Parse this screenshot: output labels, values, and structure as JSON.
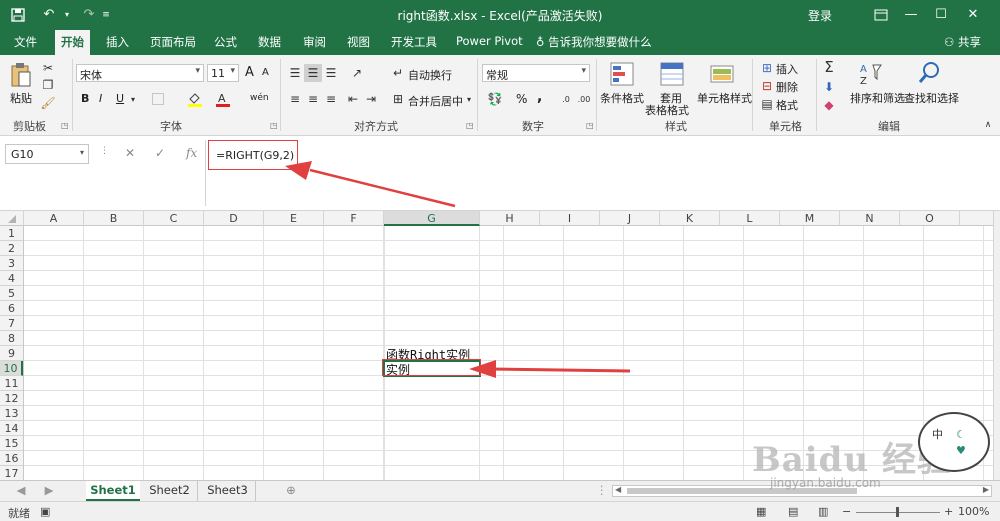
{
  "app": {
    "title": "right函数.xlsx - Excel(产品激活失败)",
    "login": "登录",
    "quick_access": {
      "save_icon": "save-icon",
      "undo_icon": "undo-icon",
      "redo_icon": "redo-icon",
      "customize_icon": "customize-icon"
    },
    "window_buttons": {
      "ribbon_display": "ribbon-display-icon",
      "minimize": "minimize-icon",
      "maximize": "maximize-icon",
      "close": "close-icon"
    }
  },
  "tabs": [
    "文件",
    "开始",
    "插入",
    "页面布局",
    "公式",
    "数据",
    "审阅",
    "视图",
    "开发工具",
    "Power Pivot"
  ],
  "active_tab": "开始",
  "tell_me": "告诉我你想要做什么",
  "share": "共享",
  "ribbon": {
    "clipboard": {
      "paste": "粘贴",
      "label": "剪贴板"
    },
    "font": {
      "name": "宋体",
      "size": "11",
      "bold": "B",
      "italic": "I",
      "underline": "U",
      "phonetic": "wén",
      "grow": "A",
      "shrink": "A",
      "label": "字体"
    },
    "alignment": {
      "wrap": "自动换行",
      "merge": "合并后居中",
      "label": "对齐方式"
    },
    "number": {
      "format": "常规",
      "percent": "%",
      "comma": ",",
      "label": "数字"
    },
    "styles": {
      "conditional": "条件格式",
      "table_line1": "套用",
      "table_line2": "表格格式",
      "cell_styles": "单元格样式",
      "label": "样式"
    },
    "cells": {
      "insert": "插入",
      "delete": "删除",
      "format": "格式",
      "label": "单元格"
    },
    "editing": {
      "sort": "排序和筛选",
      "find": "查找和选择",
      "label": "编辑"
    }
  },
  "formula_bar": {
    "name_box": "G10",
    "formula": "=RIGHT(G9,2)",
    "cancel": "✕",
    "enter": "✓",
    "fx": "fx"
  },
  "columns": [
    "A",
    "B",
    "C",
    "D",
    "E",
    "F",
    "G",
    "H",
    "I",
    "J",
    "K",
    "L",
    "M",
    "N",
    "O"
  ],
  "selected_column": "G",
  "rows": [
    "1",
    "2",
    "3",
    "4",
    "5",
    "6",
    "7",
    "8",
    "9",
    "10",
    "11",
    "12",
    "13",
    "14",
    "15",
    "16",
    "17"
  ],
  "selected_row": "10",
  "cells": {
    "G9": "函数Right实例",
    "G10": "实例"
  },
  "sheets": [
    "Sheet1",
    "Sheet2",
    "Sheet3"
  ],
  "active_sheet": "Sheet1",
  "status": {
    "ready": "就绪",
    "zoom": "100%"
  },
  "watermark": {
    "text": "Baidu 经验",
    "url": "jingyan.baidu.com"
  },
  "bubble": {
    "char1": "中",
    "char2": "☾",
    "char3": "♥"
  },
  "colors": {
    "excel_green": "#217346",
    "annotation_red": "#e04040"
  }
}
